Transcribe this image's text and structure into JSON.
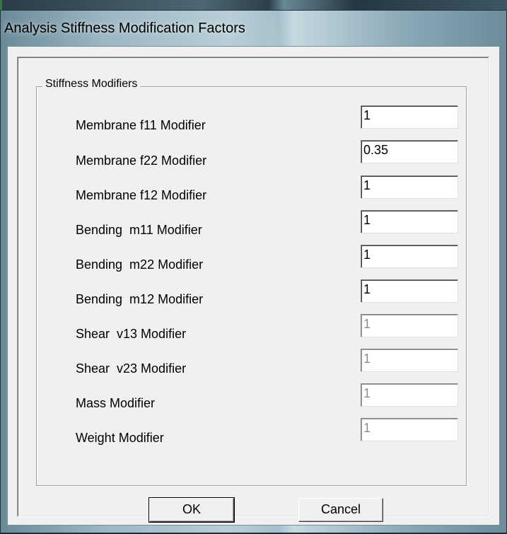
{
  "window": {
    "title": "Analysis Stiffness Modification Factors"
  },
  "group": {
    "legend": "Stiffness Modifiers"
  },
  "rows": [
    {
      "label": "Membrane f11 Modifier",
      "value": "1",
      "enabled": true
    },
    {
      "label": "Membrane f22 Modifier",
      "value": "0.35",
      "enabled": true
    },
    {
      "label": "Membrane f12 Modifier",
      "value": "1",
      "enabled": true
    },
    {
      "label": "Bending  m11 Modifier",
      "value": "1",
      "enabled": true
    },
    {
      "label": "Bending  m22 Modifier",
      "value": "1",
      "enabled": true
    },
    {
      "label": "Bending  m12 Modifier",
      "value": "1",
      "enabled": true
    },
    {
      "label": "Shear  v13 Modifier",
      "value": "1",
      "enabled": false
    },
    {
      "label": "Shear  v23 Modifier",
      "value": "1",
      "enabled": false
    },
    {
      "label": "Mass Modifier",
      "value": "1",
      "enabled": false
    },
    {
      "label": "Weight Modifier",
      "value": "1",
      "enabled": false
    }
  ],
  "buttons": {
    "ok": "OK",
    "cancel": "Cancel"
  },
  "colors": {
    "dialog_face": "#f0f0f0",
    "disabled_text": "#8c8c8c"
  }
}
